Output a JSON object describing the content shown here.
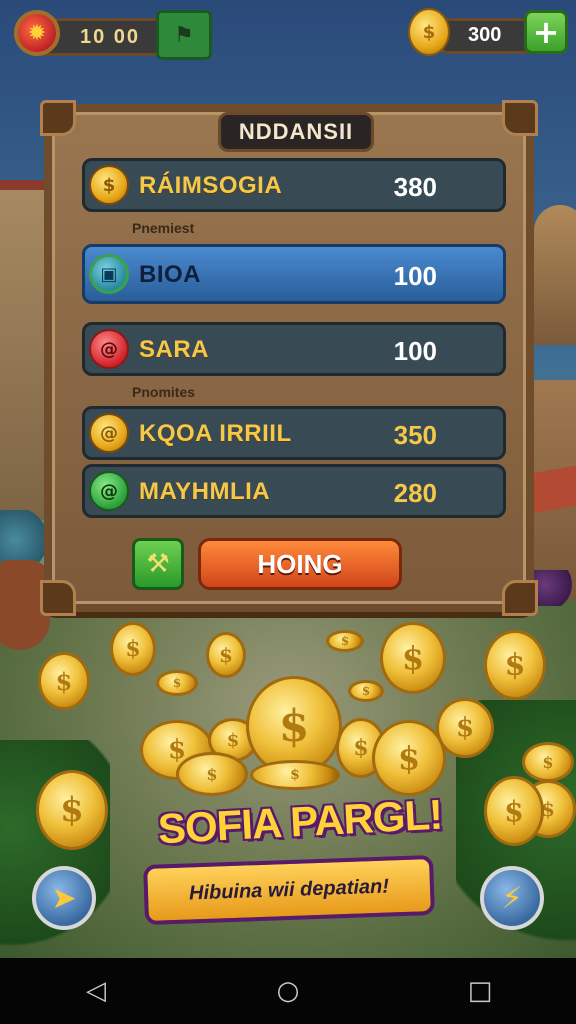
{
  "hud": {
    "left_value": "10 00",
    "right_value": "300",
    "left_badge_icon": "sun-badge-icon",
    "flag_icon": "flag-icon",
    "coin_icon": "coin-icon",
    "plus_label": "+"
  },
  "panel": {
    "title": "NDDANSII",
    "rows": [
      {
        "label": "RÁIMSOGIA",
        "value": "380",
        "icon": "coin-icon"
      },
      {
        "label": "BIOA",
        "value": "100",
        "icon": "shield-icon",
        "selected": true
      },
      {
        "label": "SARA",
        "value": "100",
        "icon": "swirl-icon"
      },
      {
        "label": "KQOA IRRIIL",
        "value": "350",
        "icon": "coin-icon"
      },
      {
        "label": "MAYHMLIA",
        "value": "280",
        "icon": "green-gem-icon"
      }
    ],
    "subheadings": [
      "Pnemiest",
      "Pnomites"
    ],
    "tool_button_icon": "hammer-icon",
    "action_button": "HOING"
  },
  "promo": {
    "title": "SOFIA PARGL!",
    "banner_text": "Hibuina wii depatian!"
  },
  "corner_buttons": {
    "left_icon": "map-arrow-icon",
    "right_icon": "lightning-icon"
  },
  "navbar": {
    "back": "◁",
    "home": "○",
    "recent": "□"
  },
  "colors": {
    "panel_wood": "#8a6644",
    "gold": "#f5c84a",
    "selected_row": "#3a78bc",
    "action_orange": "#e8612a"
  }
}
